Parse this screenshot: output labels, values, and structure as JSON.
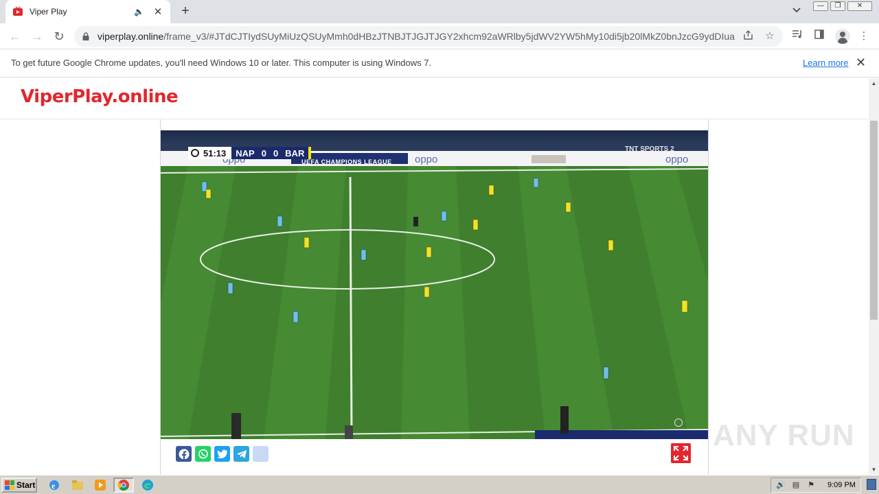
{
  "browser": {
    "tab": {
      "title": "Viper Play"
    },
    "address": {
      "host": "viperplay.online",
      "path": "/frame_v3/#JTdCJTIydSUyMiUzQSUyMmh0dHBzJTNBJTJGJTJGY2xhcm92aWRlby5jdWV2YW5hMy10di5jb20lMkZ0bnJzcG9ydDIuaHR..."
    },
    "infobar": {
      "message": "To get future Google Chrome updates, you'll need Windows 10 or later. This computer is using Windows 7.",
      "link": "Learn more"
    }
  },
  "site": {
    "logo": "ViperPlay.online"
  },
  "video": {
    "scorebug": {
      "time": "51:13",
      "home": "NAP",
      "home_score": "0",
      "away_score": "0",
      "away": "BAR"
    },
    "competition": "UEFA CHAMPIONS LEAGUE",
    "broadcaster": "TNT SPORTS 2"
  },
  "share": [
    {
      "name": "Facebook",
      "color": "#3b5998",
      "icon": "facebook-icon"
    },
    {
      "name": "WhatsApp",
      "color": "#25d366",
      "icon": "whatsapp-icon"
    },
    {
      "name": "Twitter",
      "color": "#1da1f2",
      "icon": "twitter-icon"
    },
    {
      "name": "Telegram",
      "color": "#2ca5e0",
      "icon": "telegram-icon"
    },
    {
      "name": "More",
      "color": "#c9d8f5",
      "icon": "share-icon"
    }
  ],
  "watermark": "ANY RUN",
  "taskbar": {
    "start": "Start",
    "clock": "9:09 PM"
  }
}
